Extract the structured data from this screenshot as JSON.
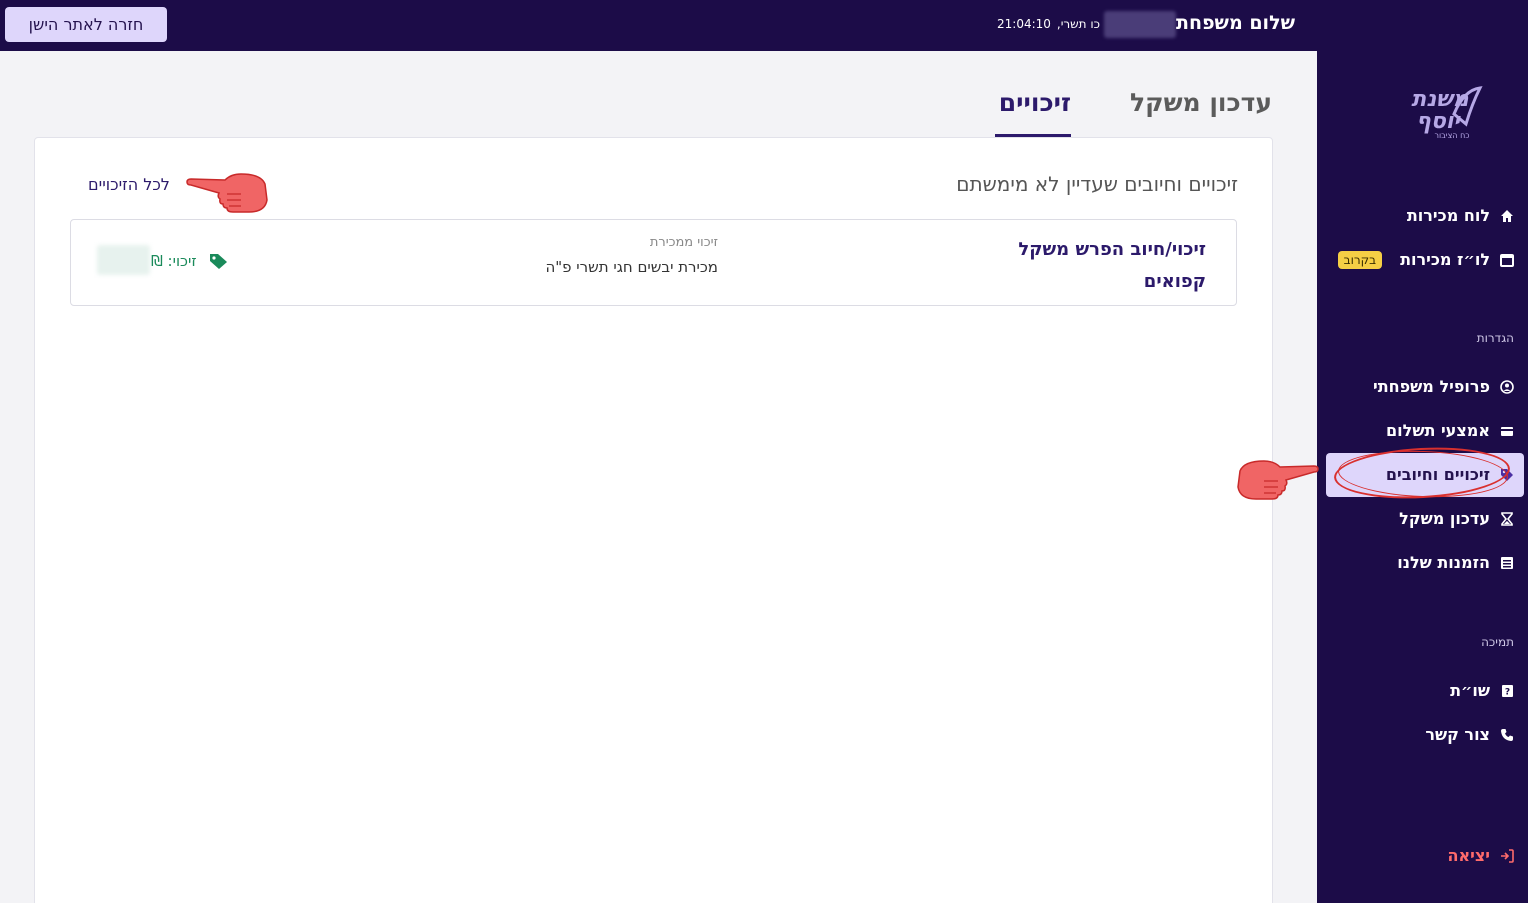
{
  "header": {
    "back_button": "חזרה לאתר הישן",
    "greeting": "שלום משפחת",
    "hebrew_date": "כו תשרי,",
    "time": "21:04:10"
  },
  "logo": {
    "line1": "משנת",
    "line2": "יוסף",
    "tagline": "כח הציבור"
  },
  "sidebar": {
    "items": [
      {
        "label": "לוח מכירות",
        "icon": "home-icon"
      },
      {
        "label": "לו״ז מכירות",
        "icon": "calendar-icon",
        "badge": "בקרוב"
      }
    ],
    "section_settings": "הגדרות",
    "settings_items": [
      {
        "label": "פרופיל משפחתי",
        "icon": "user-circle-icon"
      },
      {
        "label": "אמצעי תשלום",
        "icon": "credit-card-icon"
      },
      {
        "label": "זיכויים וחיובים",
        "icon": "tag-icon",
        "active": true
      },
      {
        "label": "עדכון משקל",
        "icon": "hourglass-icon"
      },
      {
        "label": "הזמנות שלנו",
        "icon": "list-icon"
      }
    ],
    "section_support": "תמיכה",
    "support_items": [
      {
        "label": "שו״ת",
        "icon": "question-book-icon"
      },
      {
        "label": "צור קשר",
        "icon": "phone-icon"
      }
    ],
    "logout": "יציאה"
  },
  "tabs": {
    "weight": "עדכון משקל",
    "credits": "זיכויים"
  },
  "card": {
    "title": "זיכויים וחיובים שעדיין לא מימשתם",
    "all_link": "לכל הזיכויים",
    "row": {
      "title": "זיכוי/חיוב הפרש משקל קפואים",
      "sub_label": "זיכוי ממכירת",
      "sale_name": "מכירת יבשים חגי תשרי פ\"ה",
      "credit_label": "זיכוי: ₪"
    }
  },
  "colors": {
    "primary_dark": "#1c0c48",
    "accent": "#2c1a6b",
    "active_bg": "#ded6fb",
    "badge": "#f5cf45",
    "credit": "#1a8a5a",
    "logout": "#ff6b6b"
  }
}
